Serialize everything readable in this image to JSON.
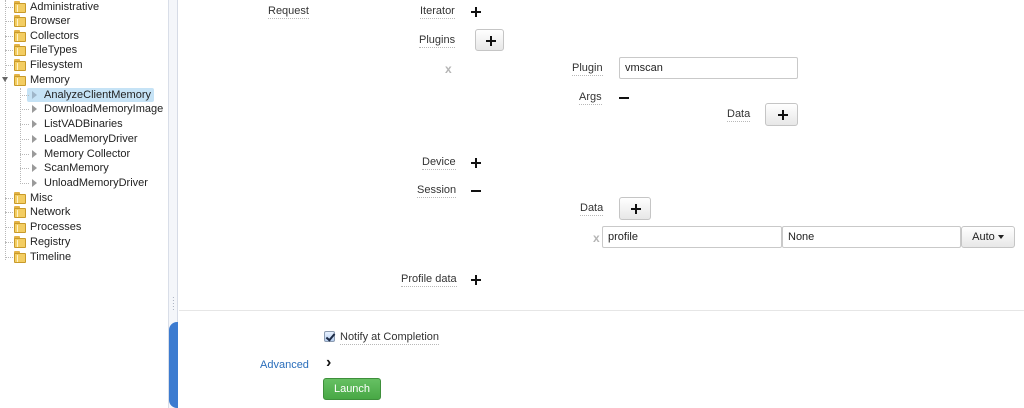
{
  "tree": {
    "items": [
      {
        "label": "Administrative"
      },
      {
        "label": "Browser"
      },
      {
        "label": "Collectors"
      },
      {
        "label": "FileTypes"
      },
      {
        "label": "Filesystem"
      },
      {
        "label": "Memory"
      },
      {
        "label": "AnalyzeClientMemory",
        "selected": true
      },
      {
        "label": "DownloadMemoryImage"
      },
      {
        "label": "ListVADBinaries"
      },
      {
        "label": "LoadMemoryDriver"
      },
      {
        "label": "Memory Collector"
      },
      {
        "label": "ScanMemory"
      },
      {
        "label": "UnloadMemoryDriver"
      },
      {
        "label": "Misc"
      },
      {
        "label": "Network"
      },
      {
        "label": "Processes"
      },
      {
        "label": "Registry"
      },
      {
        "label": "Timeline"
      }
    ]
  },
  "form": {
    "request_label": "Request",
    "iterator_label": "Iterator",
    "plugins_label": "Plugins",
    "remove_x": "x",
    "plugin_label": "Plugin",
    "plugin_value": "vmscan",
    "args_label": "Args",
    "data_label": "Data",
    "device_label": "Device",
    "session_label": "Session",
    "session_data_label": "Data",
    "session_key_value": "profile",
    "session_val_value": "None",
    "auto_label": "Auto",
    "profile_data_label": "Profile data",
    "notify_label": "Notify at Completion",
    "notify_checked": true,
    "advanced_label": "Advanced",
    "advanced_chevron": "›",
    "launch_label": "Launch"
  },
  "colors": {
    "selected_bg": "#c6e3f6",
    "launch_green": "#5cb85c",
    "link_blue": "#2a6ebb",
    "splitter_blue": "#3c7bd0"
  }
}
